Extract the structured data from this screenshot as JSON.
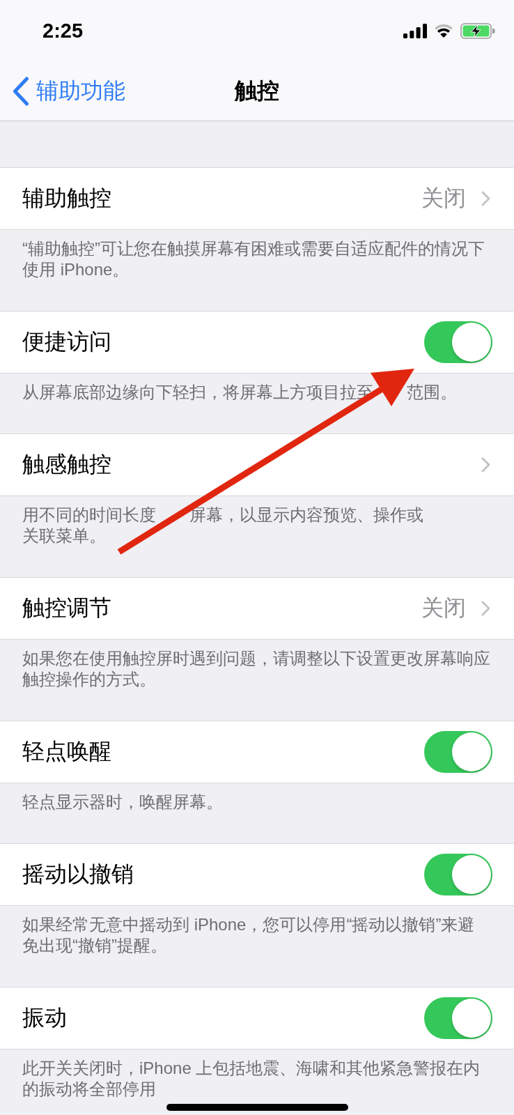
{
  "status_bar": {
    "time": "2:25"
  },
  "nav_bar": {
    "back": "辅助功能",
    "title": "触控"
  },
  "sections": [
    {
      "label": "辅助触控",
      "kind": "link",
      "value": "关闭",
      "arrow": false,
      "footer": [
        "“辅助触控”可让您在触摸屏幕有困难或需要自适应配件的情况下使用 iPhone。"
      ]
    },
    {
      "label": "便捷访问",
      "kind": "toggle",
      "on": true,
      "arrow": true,
      "footer": [
        "从屏幕底部边缘向下轻扫，将屏幕上方项目拉至",
        "范围。"
      ]
    },
    {
      "label": "触感触控",
      "kind": "link",
      "arrow": false,
      "footer": [
        "用不同的时间长度",
        "屏幕，以显示内容预览、操作或关联菜单。"
      ]
    },
    {
      "label": "触控调节",
      "kind": "link",
      "value": "关闭",
      "arrow": false,
      "footer": [
        "如果您在使用触控屏时遇到问题，请调整以下设置更改屏幕响应触控操作的方式。"
      ]
    },
    {
      "label": "轻点唤醒",
      "kind": "toggle",
      "on": true,
      "arrow": false,
      "footer": [
        "轻点显示器时，唤醒屏幕。"
      ]
    },
    {
      "label": "摇动以撤销",
      "kind": "toggle",
      "on": true,
      "arrow": false,
      "footer": [
        "如果经常无意中摇动到 iPhone，您可以停用“摇动以撤销”来避免出现“撤销”提醒。"
      ]
    },
    {
      "label": "振动",
      "kind": "toggle",
      "on": true,
      "arrow": false,
      "footer": [
        "此开关关闭时，iPhone 上包括地震、海啸和其他紧急警报在内的振动将全部停用"
      ]
    }
  ]
}
